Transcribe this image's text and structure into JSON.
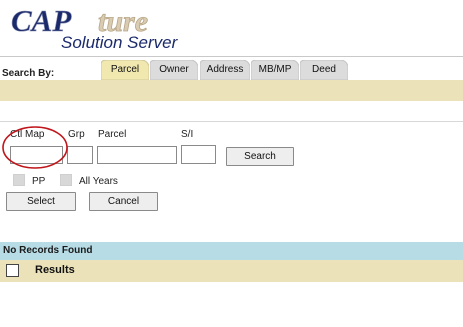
{
  "logo": {
    "text": "CAPture Solution Server",
    "colors": {
      "brand_navy": "#1b2a6b",
      "brand_tan": "#b7a585"
    }
  },
  "search_by_label": "Search By:",
  "tabs": [
    {
      "label": "Parcel",
      "active": true
    },
    {
      "label": "Owner",
      "active": false
    },
    {
      "label": "Address",
      "active": false
    },
    {
      "label": "MB/MP",
      "active": false
    },
    {
      "label": "Deed",
      "active": false
    }
  ],
  "form": {
    "ctl_map_label": "Ctl Map",
    "grp_label": "Grp",
    "parcel_label": "Parcel",
    "si_label": "S/I",
    "ctl_map_value": "",
    "grp_value": "",
    "parcel_value": "",
    "si_value": "",
    "search_button": "Search",
    "pp_label": "PP",
    "all_years_label": "All Years",
    "select_button": "Select",
    "cancel_button": "Cancel"
  },
  "results": {
    "status": "No Records Found",
    "header": "Results"
  },
  "colors": {
    "tab_band": "#ebe2b9",
    "tab_active": "#f1e8b0",
    "tab_inactive": "#dcdcdc",
    "status_bar": "#b8dce6",
    "highlight_ring": "#c0151b"
  }
}
